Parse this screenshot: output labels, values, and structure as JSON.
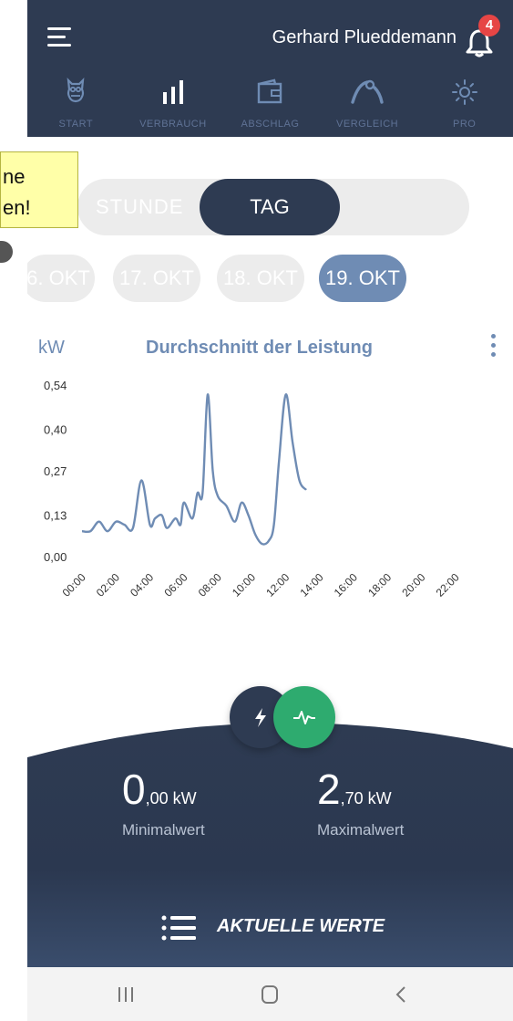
{
  "header": {
    "user_name": "Gerhard Plueddemann",
    "notification_count": "4"
  },
  "nav": {
    "items": [
      {
        "label": "START",
        "icon": "owl-icon"
      },
      {
        "label": "VERBRAUCH",
        "icon": "bar-chart-icon"
      },
      {
        "label": "ABSCHLAG",
        "icon": "wallet-icon"
      },
      {
        "label": "VERGLEICH",
        "icon": "gauge-icon"
      },
      {
        "label": "PRO",
        "icon": "sun-icon"
      }
    ]
  },
  "tooltip": {
    "line1": "ne",
    "line2": "en!"
  },
  "segment": {
    "options": [
      "STUNDE",
      "TAG"
    ],
    "selected": "TAG"
  },
  "dates": {
    "chips": [
      "6. OKT",
      "17. OKT",
      "18. OKT",
      "19. OKT"
    ],
    "selected": "19. OKT"
  },
  "chart_data": {
    "type": "line",
    "title": "Durchschnitt der Leistung",
    "ylabel": "kW",
    "yticks": [
      "0,54",
      "0,40",
      "0,27",
      "0,13",
      "0,00"
    ],
    "ytick_values": [
      0.54,
      0.4,
      0.27,
      0.13,
      0.0
    ],
    "xticks": [
      "00:00",
      "02:00",
      "04:00",
      "06:00",
      "08:00",
      "10:00",
      "12:00",
      "14:00",
      "16:00",
      "18:00",
      "20:00",
      "22:00"
    ],
    "ylim": [
      0,
      0.54
    ],
    "series": [
      {
        "x": [
          0,
          0.5,
          1.0,
          1.5,
          2.0,
          2.5,
          3.0,
          3.5,
          4.0,
          4.3,
          4.7,
          5.0,
          5.5,
          5.8,
          6.0,
          6.5,
          6.8,
          7.1,
          7.4,
          7.7,
          8.0,
          8.5,
          9.0,
          9.4,
          9.8,
          10.2,
          10.6,
          11.0,
          11.3,
          11.6,
          12.0,
          12.4,
          12.8,
          13.2
        ],
        "values": [
          0.08,
          0.08,
          0.11,
          0.08,
          0.11,
          0.1,
          0.09,
          0.24,
          0.1,
          0.12,
          0.13,
          0.09,
          0.12,
          0.1,
          0.17,
          0.12,
          0.2,
          0.2,
          0.51,
          0.27,
          0.19,
          0.16,
          0.11,
          0.17,
          0.13,
          0.07,
          0.04,
          0.05,
          0.1,
          0.3,
          0.51,
          0.36,
          0.24,
          0.21
        ]
      }
    ],
    "grid": false,
    "color": "#6f8cb4"
  },
  "stats": {
    "min_value_big": "0",
    "min_value_small": ",00 kW",
    "min_label": "Minimalwert",
    "max_value_big": "2",
    "max_value_small": ",70 kW",
    "max_label": "Maximalwert"
  },
  "fabs": {
    "left_icon": "lightning-icon",
    "right_icon": "pulse-icon",
    "left_color": "#2e3b52",
    "right_color": "#2eab6f"
  },
  "aktuelle": {
    "label": "AKTUELLE WERTE"
  },
  "colors": {
    "header": "#2e3b52",
    "accent": "#6f8cb4",
    "green": "#2eab6f",
    "badge": "#e64545"
  }
}
